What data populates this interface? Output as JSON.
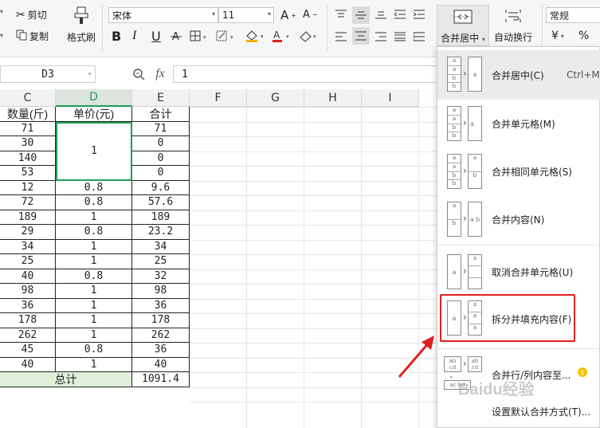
{
  "ribbon": {
    "cut": "剪切",
    "copy": "复制",
    "format_painter": "格式刷",
    "font_name": "宋体",
    "font_size": "11",
    "merge_center": "合并居中",
    "auto_wrap": "自动换行",
    "number_format": "常规",
    "bold": "B",
    "italic": "I",
    "underline": "U",
    "currency": "¥",
    "percent": "%",
    "grow_font": "A",
    "shrink_font": "A"
  },
  "formula_bar": {
    "name_box": "D3",
    "fx": "fx",
    "value": "1"
  },
  "grid": {
    "col_headers": [
      "C",
      "D",
      "E",
      "F",
      "G",
      "H",
      "I"
    ],
    "active_col": "D",
    "headers": [
      "数量(斤)",
      "单价(元)",
      "合计"
    ],
    "rows": [
      [
        "71",
        "",
        "71"
      ],
      [
        "30",
        "",
        "0"
      ],
      [
        "140",
        "",
        "0"
      ],
      [
        "53",
        "",
        "0"
      ],
      [
        "12",
        "0.8",
        "9.6"
      ],
      [
        "72",
        "0.8",
        "57.6"
      ],
      [
        "189",
        "1",
        "189"
      ],
      [
        "29",
        "0.8",
        "23.2"
      ],
      [
        "34",
        "1",
        "34"
      ],
      [
        "25",
        "1",
        "25"
      ],
      [
        "40",
        "0.8",
        "32"
      ],
      [
        "98",
        "1",
        "98"
      ],
      [
        "36",
        "1",
        "36"
      ],
      [
        "178",
        "1",
        "178"
      ],
      [
        "262",
        "1",
        "262"
      ],
      [
        "45",
        "0.8",
        "36"
      ],
      [
        "40",
        "1",
        "40"
      ]
    ],
    "merged_value": "1",
    "total_label": "总计",
    "total_value": "1091.4"
  },
  "menu": {
    "items": [
      {
        "label": "合并居中(C)",
        "shortcut": "Ctrl+M"
      },
      {
        "label": "合并单元格(M)"
      },
      {
        "label": "合并相同单元格(S)"
      },
      {
        "label": "合并内容(N)"
      },
      {
        "label": "取消合并单元格(U)"
      },
      {
        "label": "拆分并填充内容(F)"
      },
      {
        "label": "合并行/列内容至..."
      },
      {
        "label": "设置默认合并方式(T)..."
      }
    ],
    "highlight_color": "#e02020"
  },
  "watermark": "Baidu经验"
}
